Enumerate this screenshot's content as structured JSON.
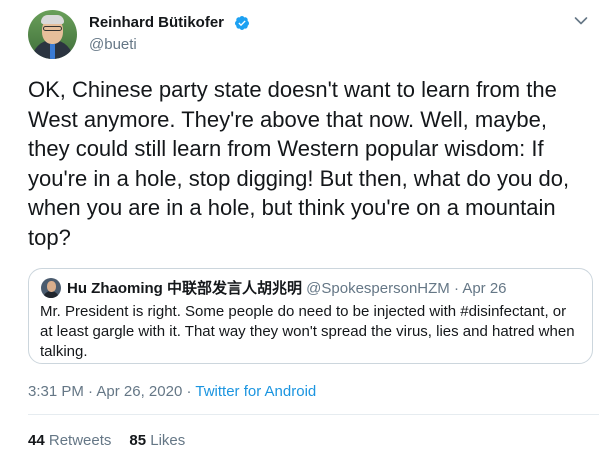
{
  "author": {
    "name": "Reinhard Bütikofer",
    "handle": "@bueti",
    "verified_icon": "verified-badge-icon"
  },
  "tweet": {
    "text": "OK, Chinese party state doesn't want to learn from the West anymore. They're above that now. Well, maybe, they could still learn from Western popular wisdom: If you're in a hole, stop digging! But then, what do you do, when you are in a hole, but think you're on a mountain top?"
  },
  "quoted": {
    "name": "Hu Zhaoming 中联部发言人胡兆明",
    "handle": "@SpokespersonHZM",
    "separator": " · ",
    "date": "Apr 26",
    "text": "Mr. President is right. Some people do need to be injected with #disinfectant, or at least gargle with it. That way they won't spread the virus, lies and hatred when talking."
  },
  "meta": {
    "time": "3:31 PM",
    "sep1": " · ",
    "date": "Apr 26, 2020",
    "sep2": " · ",
    "source": "Twitter for Android"
  },
  "stats": {
    "retweets_count": "44",
    "retweets_label": "Retweets",
    "likes_count": "85",
    "likes_label": "Likes"
  },
  "colors": {
    "link": "#1b95e0",
    "muted": "#657786",
    "border": "#ccd6dd",
    "verified": "#1da1f2"
  }
}
